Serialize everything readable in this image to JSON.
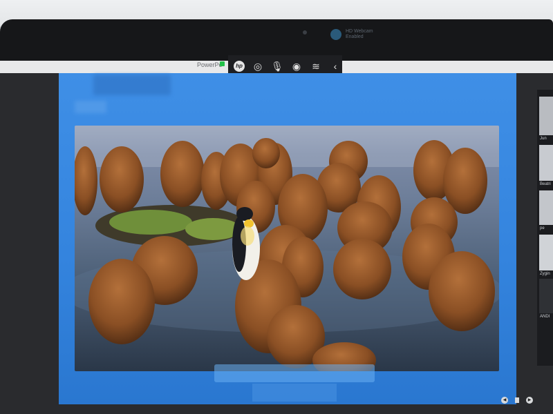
{
  "camera": {
    "name": "HD Webcam",
    "subtitle": "Enabled"
  },
  "app": {
    "ppt_label": "PowerPo"
  },
  "toolbar": {
    "hp_label": "hp",
    "icons": [
      "hp-icon",
      "record-icon",
      "microphone-icon",
      "camera-icon",
      "broadcast-icon",
      "chevron-left-icon"
    ]
  },
  "participants": [
    {
      "label": "Jun"
    },
    {
      "label": "Beatri"
    },
    {
      "label": "pe"
    },
    {
      "label": "Zygin"
    },
    {
      "label": "ANDI"
    }
  ],
  "slide_nav": {
    "icons": [
      "prev-icon",
      "page-icon",
      "next-icon"
    ]
  },
  "colors": {
    "slide_blue": "#3484de",
    "toolbar": "#1e1f22",
    "status_green": "#23c24a"
  }
}
